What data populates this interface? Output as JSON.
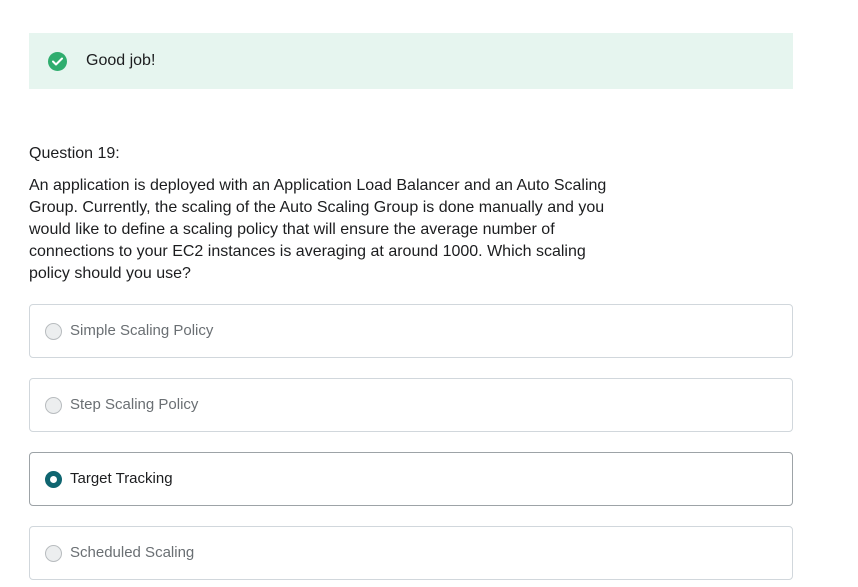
{
  "feedback": {
    "icon": "check-circle-icon",
    "message": "Good job!",
    "color": "#2fad6e",
    "background": "#e6f5ef"
  },
  "question": {
    "number_label": "Question 19:",
    "text": "An application is deployed with an Application Load Balancer and an Auto Scaling Group. Currently, the scaling of the Auto Scaling Group is done manually and you would like to define a scaling policy that will ensure the average number of connections to your EC2 instances is averaging at around 1000. Which scaling policy should you use?"
  },
  "options": [
    {
      "label": "Simple Scaling Policy",
      "selected": false
    },
    {
      "label": "Step Scaling Policy",
      "selected": false
    },
    {
      "label": "Target Tracking",
      "selected": true
    },
    {
      "label": "Scheduled Scaling",
      "selected": false
    }
  ],
  "accent_color": "#0f6570"
}
